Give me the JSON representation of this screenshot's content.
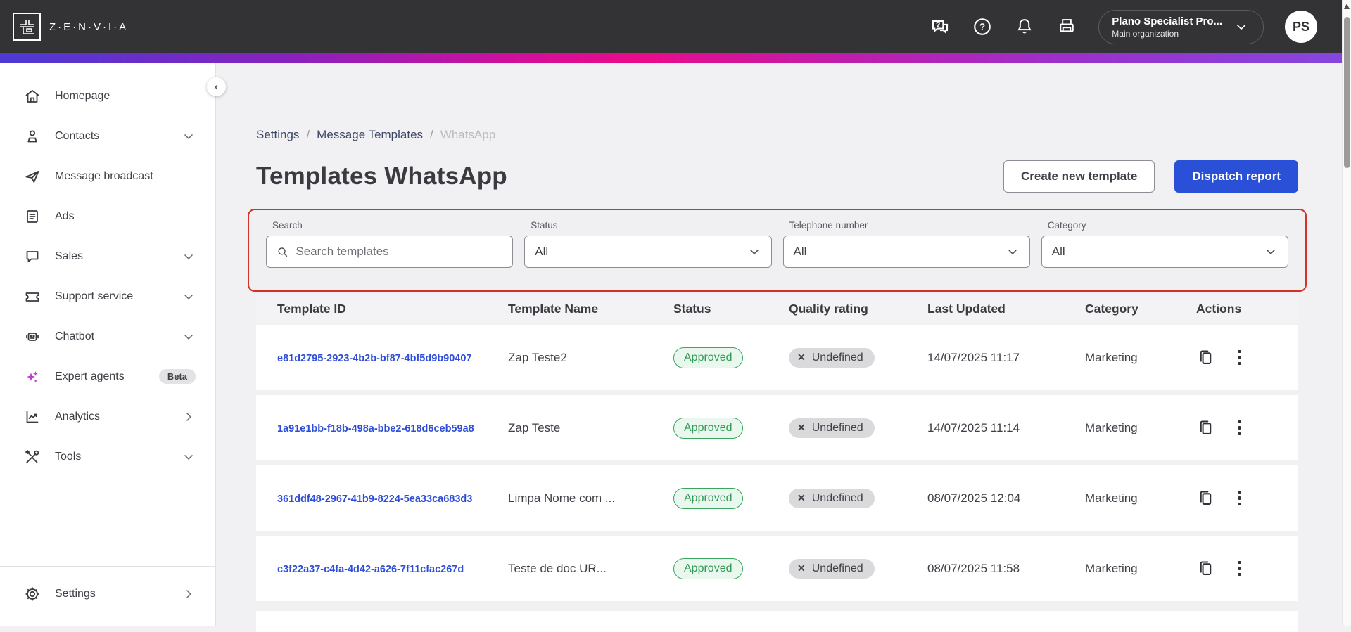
{
  "topbar": {
    "brand": "Z·E·N·V·I·A",
    "org_name": "Plano Specialist Pro...",
    "org_sub": "Main organization",
    "avatar_initials": "PS"
  },
  "sidebar": {
    "items": [
      {
        "label": "Homepage"
      },
      {
        "label": "Contacts"
      },
      {
        "label": "Message broadcast"
      },
      {
        "label": "Ads"
      },
      {
        "label": "Sales"
      },
      {
        "label": "Support service"
      },
      {
        "label": "Chatbot"
      },
      {
        "label": "Expert agents",
        "badge": "Beta"
      },
      {
        "label": "Analytics"
      },
      {
        "label": "Tools"
      }
    ],
    "settings_label": "Settings"
  },
  "breadcrumb": {
    "items": [
      "Settings",
      "Message Templates",
      "WhatsApp"
    ],
    "separator": "/"
  },
  "page": {
    "title": "Templates WhatsApp",
    "create_button": "Create new template",
    "dispatch_button": "Dispatch report"
  },
  "filters": {
    "search_label": "Search",
    "search_placeholder": "Search templates",
    "status_label": "Status",
    "status_value": "All",
    "phone_label": "Telephone number",
    "phone_value": "All",
    "category_label": "Category",
    "category_value": "All"
  },
  "table": {
    "headers": [
      "Template ID",
      "Template Name",
      "Status",
      "Quality rating",
      "Last Updated",
      "Category",
      "Actions"
    ],
    "rows": [
      {
        "id": "e81d2795-2923-4b2b-bf87-4bf5d9b90407",
        "name": "Zap Teste2",
        "status": "Approved",
        "quality": "Undefined",
        "updated": "14/07/2025 11:17",
        "category": "Marketing"
      },
      {
        "id": "1a91e1bb-f18b-498a-bbe2-618d6ceb59a8",
        "name": "Zap Teste",
        "status": "Approved",
        "quality": "Undefined",
        "updated": "14/07/2025 11:14",
        "category": "Marketing"
      },
      {
        "id": "361ddf48-2967-41b9-8224-5ea33ca683d3",
        "name": "Limpa Nome com ...",
        "status": "Approved",
        "quality": "Undefined",
        "updated": "08/07/2025 12:04",
        "category": "Marketing"
      },
      {
        "id": "c3f22a37-c4fa-4d42-a626-7f11cfac267d",
        "name": "Teste de doc UR...",
        "status": "Approved",
        "quality": "Undefined",
        "updated": "08/07/2025 11:58",
        "category": "Marketing"
      }
    ]
  },
  "colors": {
    "topbar_bg": "#333234",
    "gradient_left": "#4c3ad3",
    "gradient_mid": "#ea0b8a",
    "gradient_right": "#8547de",
    "primary_blue": "#2b50d8",
    "link_blue": "#2e4ed8",
    "approved_green": "#3aa55d",
    "highlight_red": "#d43227",
    "expert_agents_accent": "#c23bd2"
  }
}
